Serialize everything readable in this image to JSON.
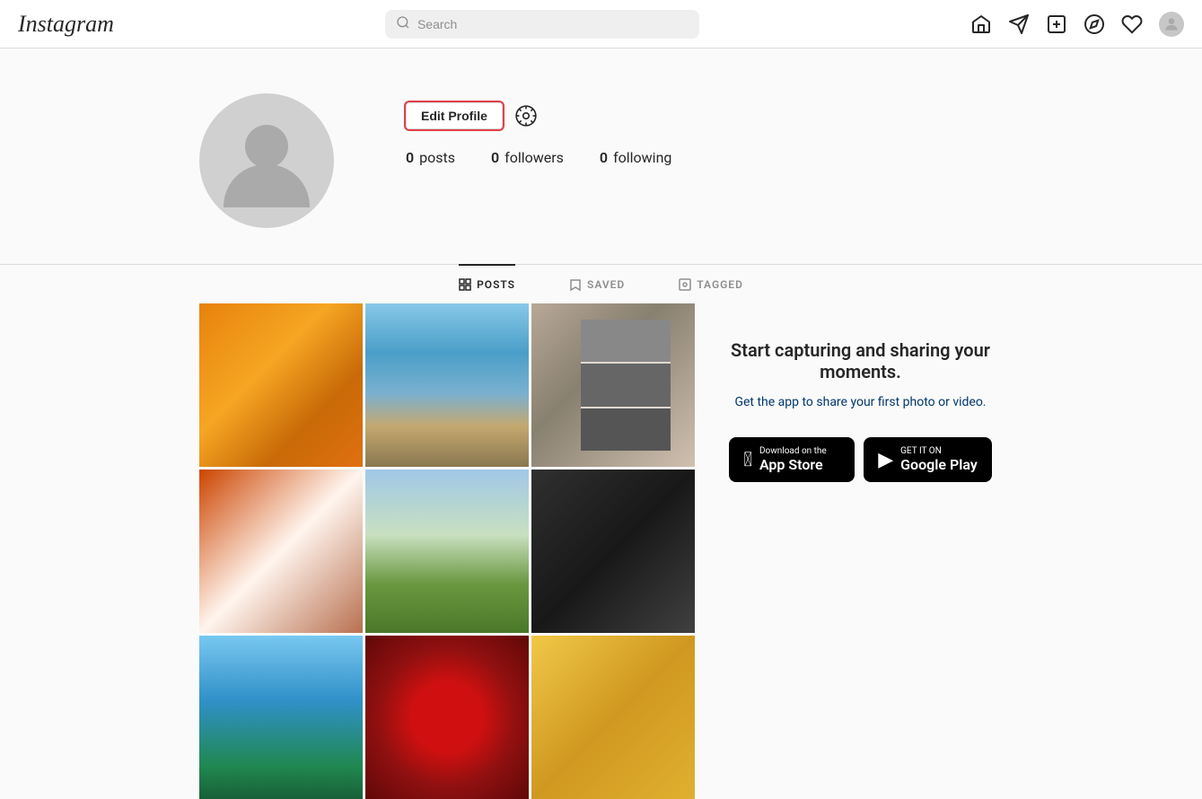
{
  "header": {
    "logo": "Instagram",
    "search_placeholder": "Search",
    "nav_icons": [
      "home",
      "direct",
      "new-post",
      "explore",
      "activity",
      "profile"
    ]
  },
  "profile": {
    "edit_button": "Edit Profile",
    "stats": {
      "posts_count": "0",
      "posts_label": "posts",
      "followers_count": "0",
      "followers_label": "followers",
      "following_count": "0",
      "following_label": "following"
    }
  },
  "tabs": [
    {
      "id": "posts",
      "label": "POSTS",
      "active": true
    },
    {
      "id": "saved",
      "label": "SAVED",
      "active": false
    },
    {
      "id": "tagged",
      "label": "TAGGED",
      "active": false
    }
  ],
  "promo": {
    "title": "Start capturing and sharing your moments.",
    "subtitle": "Get the app to share your first photo or video.",
    "appstore_small": "Download on the",
    "appstore_large": "App Store",
    "googleplay_small": "GET IT ON",
    "googleplay_large": "Google Play"
  },
  "grid": {
    "cells": [
      {
        "id": "oranges",
        "class": "cell-oranges"
      },
      {
        "id": "coast",
        "class": "cell-coast"
      },
      {
        "id": "photos",
        "class": "cell-photos"
      },
      {
        "id": "dog",
        "class": "cell-dog"
      },
      {
        "id": "cactus",
        "class": "cell-cactus"
      },
      {
        "id": "baby",
        "class": "cell-baby"
      },
      {
        "id": "ride",
        "class": "cell-ride"
      },
      {
        "id": "flowers",
        "class": "cell-flowers"
      },
      {
        "id": "cat",
        "class": "cell-cat"
      }
    ]
  }
}
